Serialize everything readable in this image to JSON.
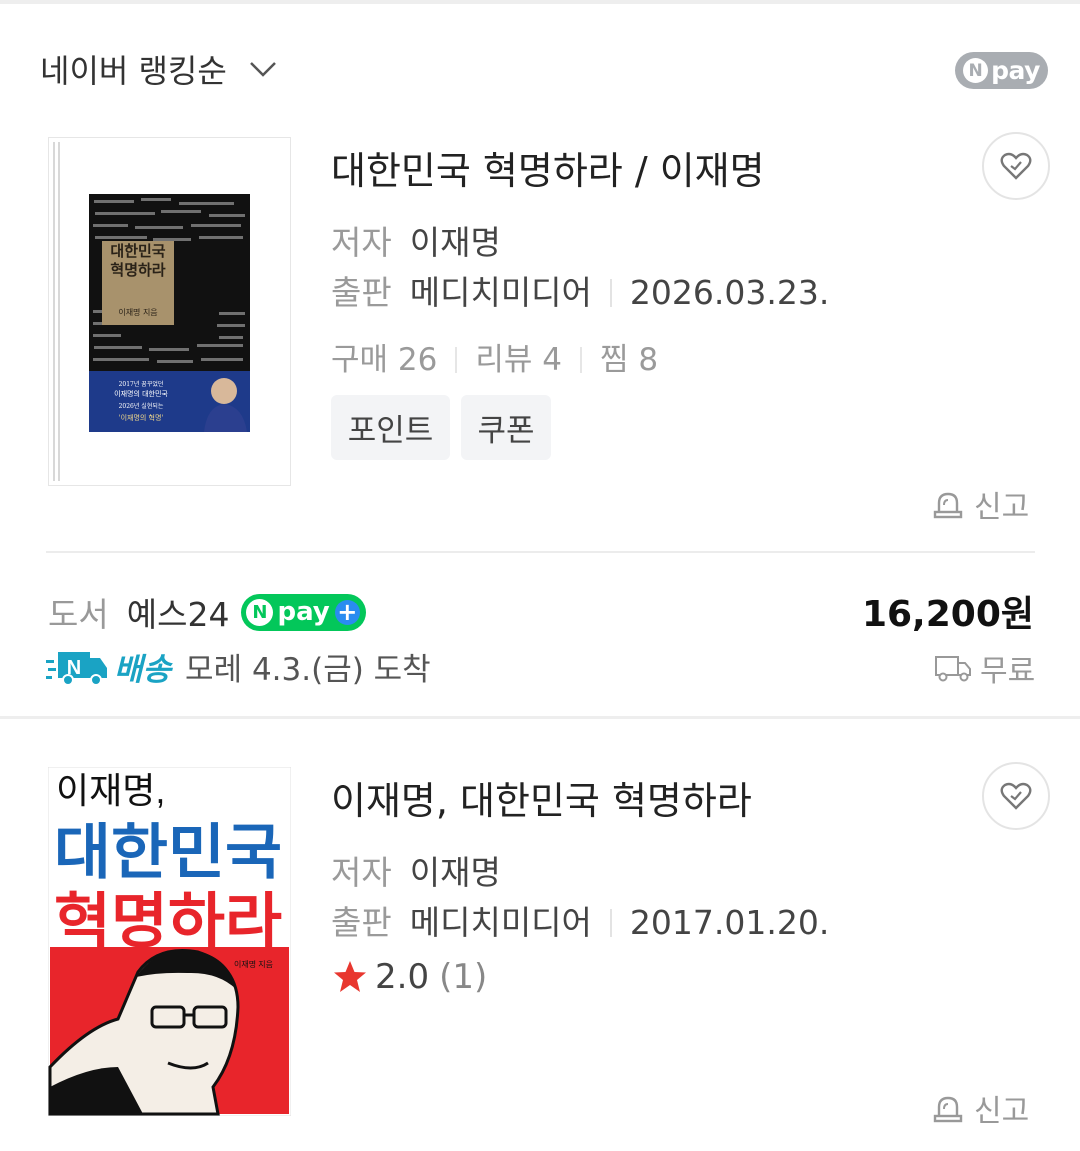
{
  "sort": {
    "label": "네이버 랭킹순"
  },
  "npay_badge": {
    "label": "pay"
  },
  "products": [
    {
      "title": "대한민국 혁명하라 / 이재명",
      "author_key": "저자",
      "author": "이재명",
      "publisher_key": "출판",
      "publisher": "메디치미디어",
      "date": "2026.03.23.",
      "stats": {
        "buy": "구매 26",
        "review": "리뷰 4",
        "zzim": "찜 8"
      },
      "chips": [
        "포인트",
        "쿠폰"
      ],
      "cover": {
        "title_line1": "대한민국",
        "title_line2": "혁명하라",
        "author_line": "이재명 지음",
        "band_line1": "2017년 꿈꾸었던",
        "band_line2": "이재명의 대한민국",
        "band_line3": "2026년 실현되는",
        "band_line4": "'이재명의 혁명'"
      },
      "report": "신고"
    },
    {
      "title": "이재명, 대한민국 혁명하라",
      "author_key": "저자",
      "author": "이재명",
      "publisher_key": "출판",
      "publisher": "메디치미디어",
      "date": "2017.01.20.",
      "rating": {
        "score": "2.0",
        "count": "(1)"
      },
      "cover": {
        "line1": "이재명,",
        "line2": "대한민국",
        "line3": "혁명하라",
        "author_line": "이재명 지음"
      },
      "report": "신고"
    }
  ],
  "seller": {
    "category": "도서",
    "store": "예스24",
    "npay_plus_label": "pay",
    "price": "16,200",
    "currency": "원",
    "delivery_label": "배송",
    "delivery_date": "모레 4.3.(금) 도착",
    "shipping": "무료"
  },
  "colors": {
    "npay_green": "#03c75a",
    "npay_gray": "#a9adb2",
    "delivery_blue": "#1aa3c4",
    "cover2_red": "#e8252b",
    "cover2_blue": "#1a66b8",
    "star_red": "#e8372f"
  }
}
